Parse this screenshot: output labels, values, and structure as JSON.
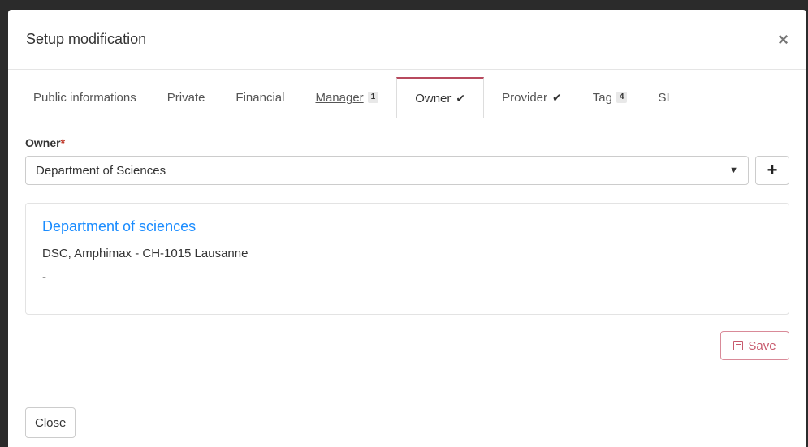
{
  "modal": {
    "title": "Setup modification",
    "close_icon": "×"
  },
  "tabs": [
    {
      "label": "Public informations",
      "badge": null,
      "check": false
    },
    {
      "label": "Private",
      "badge": null,
      "check": false
    },
    {
      "label": "Financial",
      "badge": null,
      "check": false
    },
    {
      "label": "Manager",
      "badge": "1",
      "check": false
    },
    {
      "label": "Owner",
      "badge": null,
      "check": true,
      "active": true
    },
    {
      "label": "Provider",
      "badge": null,
      "check": true
    },
    {
      "label": "Tag",
      "badge": "4",
      "check": false
    },
    {
      "label": "SI",
      "badge": null,
      "check": false
    }
  ],
  "owner": {
    "label": "Owner",
    "required_mark": "*",
    "selected": "Department of Sciences",
    "add_icon": "+"
  },
  "card": {
    "title": "Department of sciences",
    "address": "DSC, Amphimax - CH-1015 Lausanne",
    "extra": "-"
  },
  "save": {
    "label": "Save",
    "icon": "floppy-disk-icon"
  },
  "footer": {
    "close_label": "Close"
  },
  "colors": {
    "accent": "#b84a5e",
    "link": "#1a8cff",
    "save": "#c85a6d"
  }
}
